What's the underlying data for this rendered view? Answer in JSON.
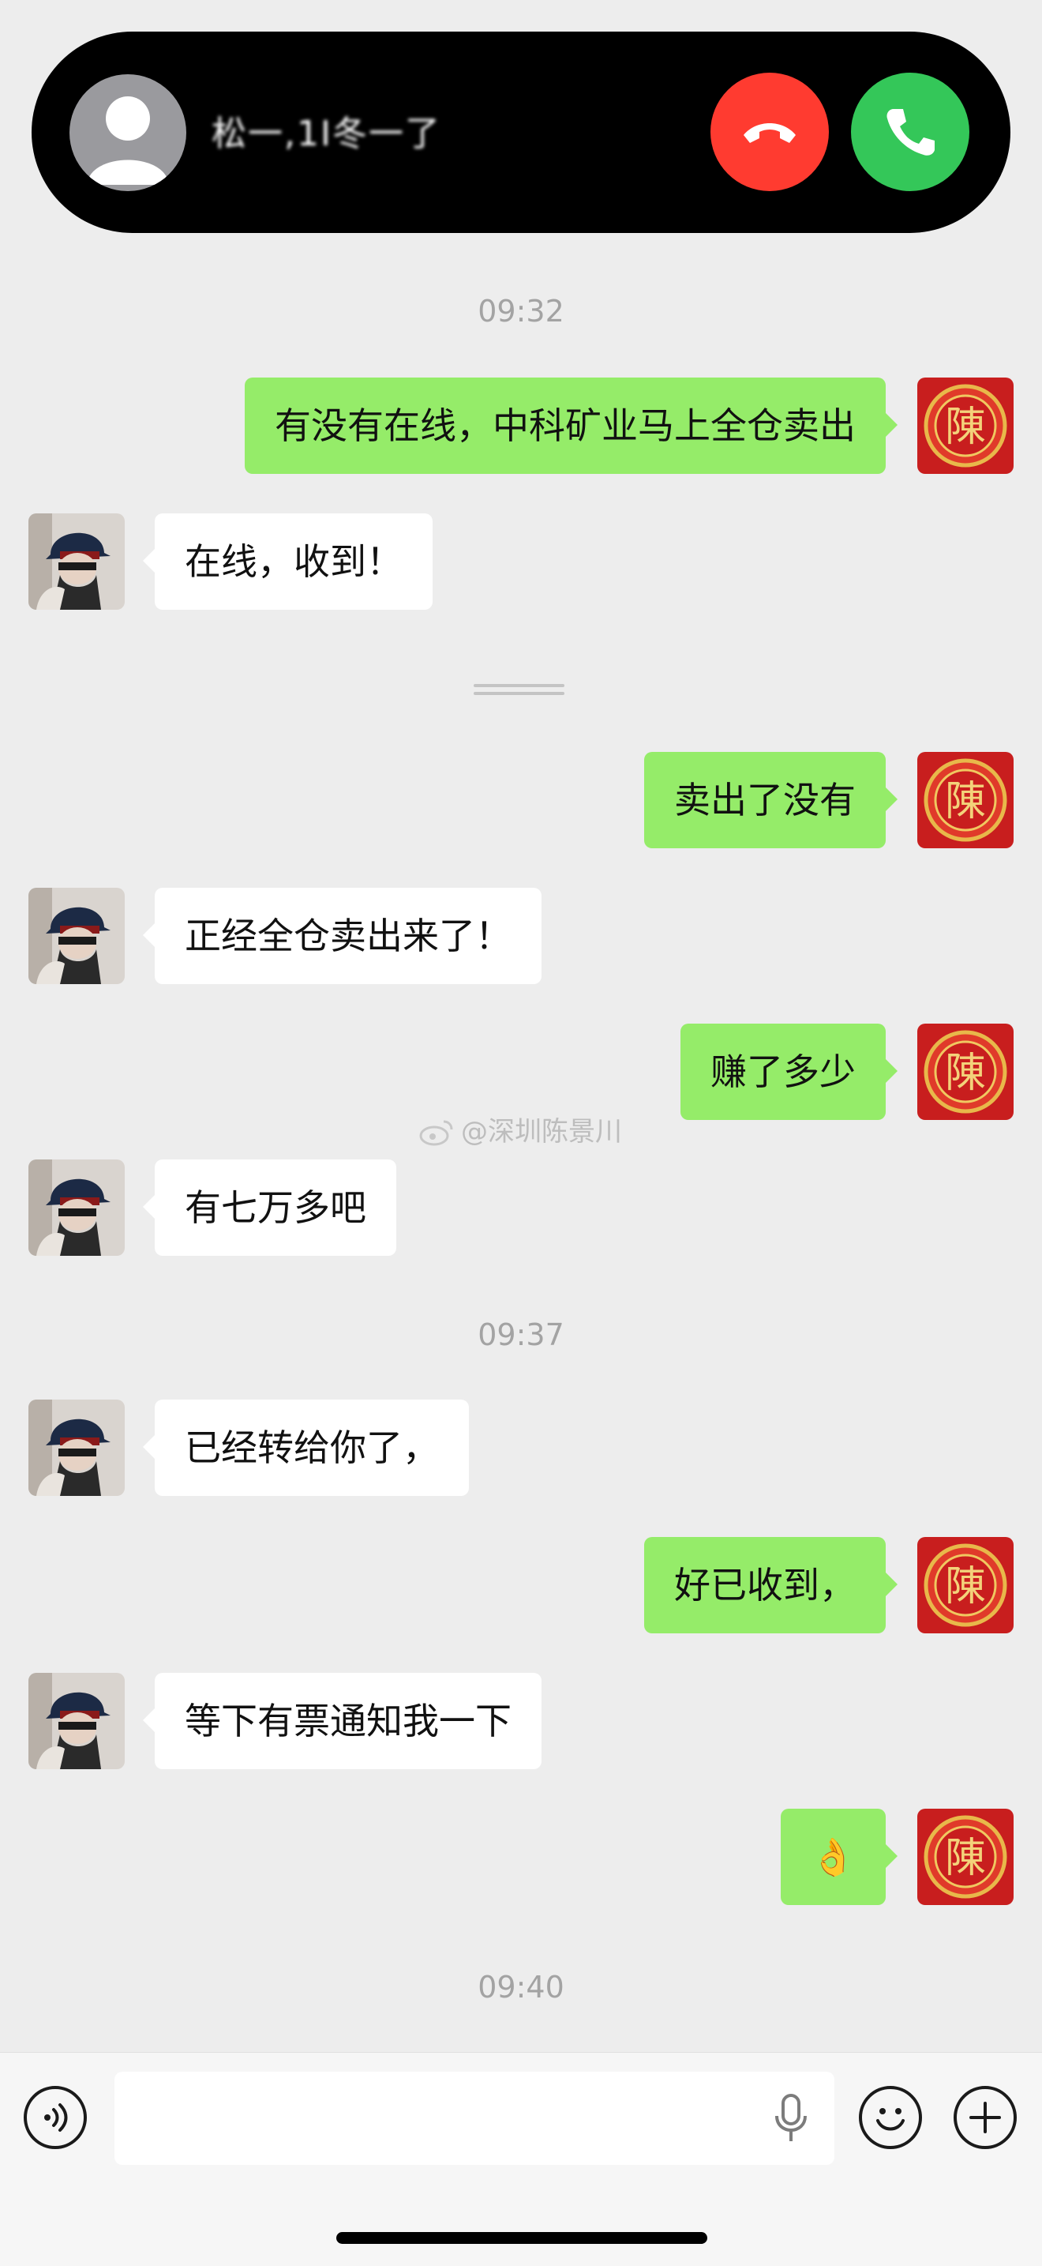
{
  "call": {
    "caller_name": "松一,1I冬一了"
  },
  "chat": {
    "timestamps": [
      "09:32",
      "09:37",
      "09:40"
    ],
    "messages": [
      {
        "side": "out",
        "text": "有没有在线，中科矿业马上全仓卖出"
      },
      {
        "side": "in",
        "text": "在线，收到！"
      },
      {
        "side": "out",
        "text": "卖出了没有"
      },
      {
        "side": "in",
        "text": "正经全仓卖出来了！"
      },
      {
        "side": "out",
        "text": "赚了多少"
      },
      {
        "side": "in",
        "text": "有七万多吧"
      },
      {
        "side": "in",
        "text": "已经转给你了，"
      },
      {
        "side": "out",
        "text": "好已收到，"
      },
      {
        "side": "in",
        "text": "等下有票通知我一下"
      },
      {
        "side": "out",
        "text": "👌"
      }
    ],
    "self_avatar_char": "陳"
  },
  "watermark": "@深圳陈景川",
  "input": {
    "placeholder": ""
  },
  "colors": {
    "background": "#ededed",
    "outgoing_bubble": "#95ec69",
    "incoming_bubble": "#ffffff",
    "decline": "#ff3b30",
    "accept": "#34c759"
  }
}
